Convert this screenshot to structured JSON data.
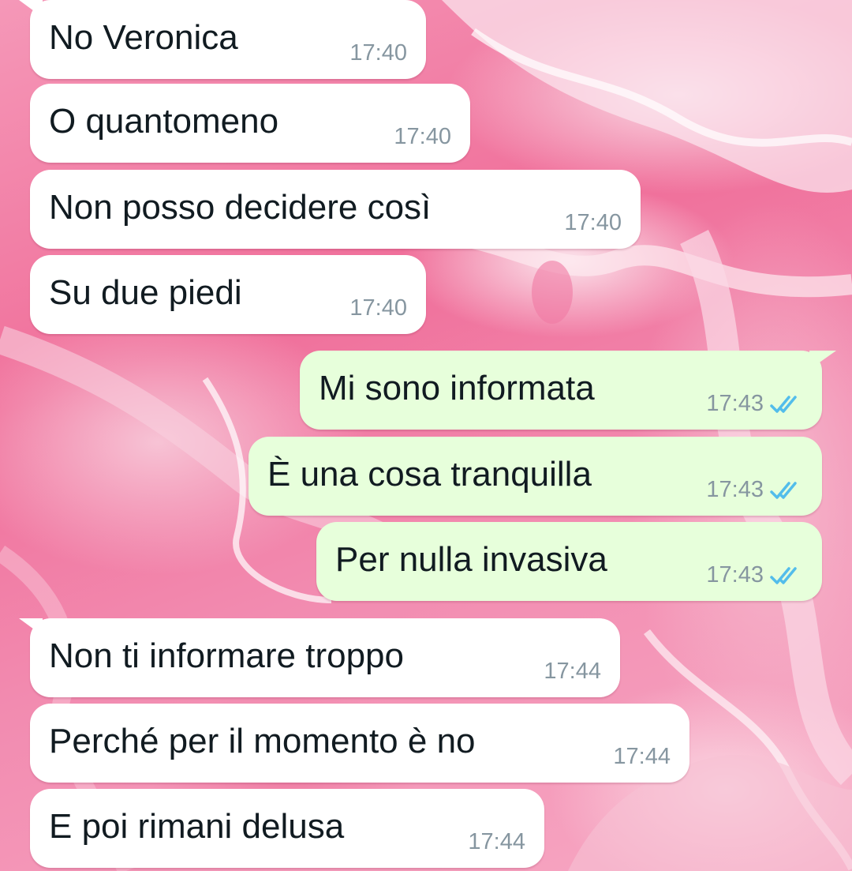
{
  "chat": {
    "messages": [
      {
        "direction": "in",
        "text": "No Veronica",
        "time": "17:40"
      },
      {
        "direction": "in",
        "text": "O quantomeno",
        "time": "17:40"
      },
      {
        "direction": "in",
        "text": "Non posso decidere così",
        "time": "17:40"
      },
      {
        "direction": "in",
        "text": "Su due piedi",
        "time": "17:40"
      },
      {
        "direction": "out",
        "text": "Mi sono informata",
        "time": "17:43",
        "status": "read-double-check-icon"
      },
      {
        "direction": "out",
        "text": "È una cosa tranquilla",
        "time": "17:43",
        "status": "read-double-check-icon"
      },
      {
        "direction": "out",
        "text": "Per nulla invasiva",
        "time": "17:43",
        "status": "read-double-check-icon"
      },
      {
        "direction": "in",
        "text": "Non ti informare troppo",
        "time": "17:44"
      },
      {
        "direction": "in",
        "text": "Perché per il momento è no",
        "time": "17:44"
      },
      {
        "direction": "in",
        "text": "E poi rimani delusa",
        "time": "17:44"
      }
    ]
  },
  "colors": {
    "incoming_bubble": "#ffffff",
    "outgoing_bubble": "#e7ffdb",
    "timestamp": "#8696a0",
    "read_ticks": "#53bdeb",
    "wallpaper": "#f06f9a"
  }
}
